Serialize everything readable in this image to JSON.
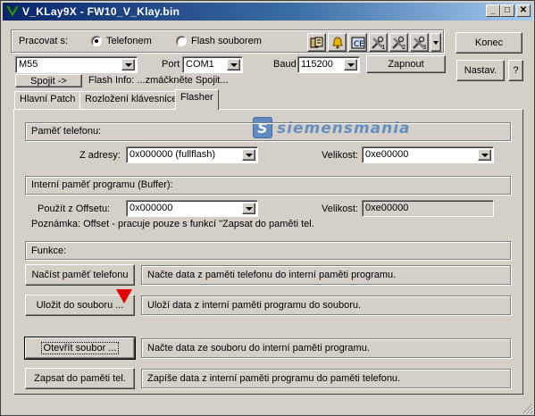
{
  "window": {
    "title": "V_KLay9X - FW10_V_Klay.bin",
    "minimize": "_",
    "maximize": "□",
    "close": "✕"
  },
  "header": {
    "work_with_label": "Pracovat s:",
    "radio_phone": "Telefonem",
    "radio_file": "Flash souborem",
    "selected_mode": "Telefonem",
    "phone_model": "M55",
    "port_label": "Port",
    "port_value": "COM1",
    "baud_label": "Baud",
    "baud_value": "115200",
    "connect_label": "Zapnout",
    "end_label": "Konec",
    "settings_label": "Nastav.",
    "help_label": "?",
    "join_label": "Spojit ->",
    "flash_info": "Flash Info: ...zmáčkněte Spojit..."
  },
  "toolbar_icons": [
    "phonebook-icon",
    "bell-icon",
    "ce-icon",
    "tools-1-icon",
    "tools-2-icon",
    "tools-3-icon",
    "dropdown-arrow-icon"
  ],
  "tabs": [
    {
      "label": "Hlavní Patch",
      "active": false
    },
    {
      "label": "Rozložení klávesnice",
      "active": false
    },
    {
      "label": "Flasher",
      "active": true
    }
  ],
  "watermark": "siemensmania",
  "phone_memory": {
    "heading": "Paměť telefonu:",
    "from_label": "Z adresy:",
    "from_value": "0x000000 (fullflash)",
    "size_label": "Velikost:",
    "size_value": "0xe00000"
  },
  "buffer": {
    "heading": "Interní paměť programu (Buffer):",
    "offset_label": "Použít z Offsetu:",
    "offset_value": "0x000000",
    "size_label": "Velikost:",
    "size_value": "0xe00000",
    "note": "Poznámka: Offset - pracuje pouze s funkcí \"Zapsat do paměti tel."
  },
  "functions": {
    "heading": "Funkce:",
    "items": [
      {
        "button": "Načíst paměť telefonu",
        "desc": "Načte data z paměti telefonu do interní paměti programu."
      },
      {
        "button": "Uložit do souboru ...",
        "desc": "Uloží data z interní paměti programu do souboru."
      },
      {
        "button": "Otevřít soubor ...",
        "desc": "Načte data ze souboru do interní paměti programu."
      },
      {
        "button": "Zapsat do paměti tel.",
        "desc": "Zapíše data z interní paměti programu do paměti telefonu."
      }
    ]
  },
  "colors": {
    "title_gradient_start": "#0a246a",
    "title_gradient_end": "#a6caf0",
    "face": "#d4d0c8",
    "marker": "#e00000",
    "watermark": "#4a7fc0"
  }
}
